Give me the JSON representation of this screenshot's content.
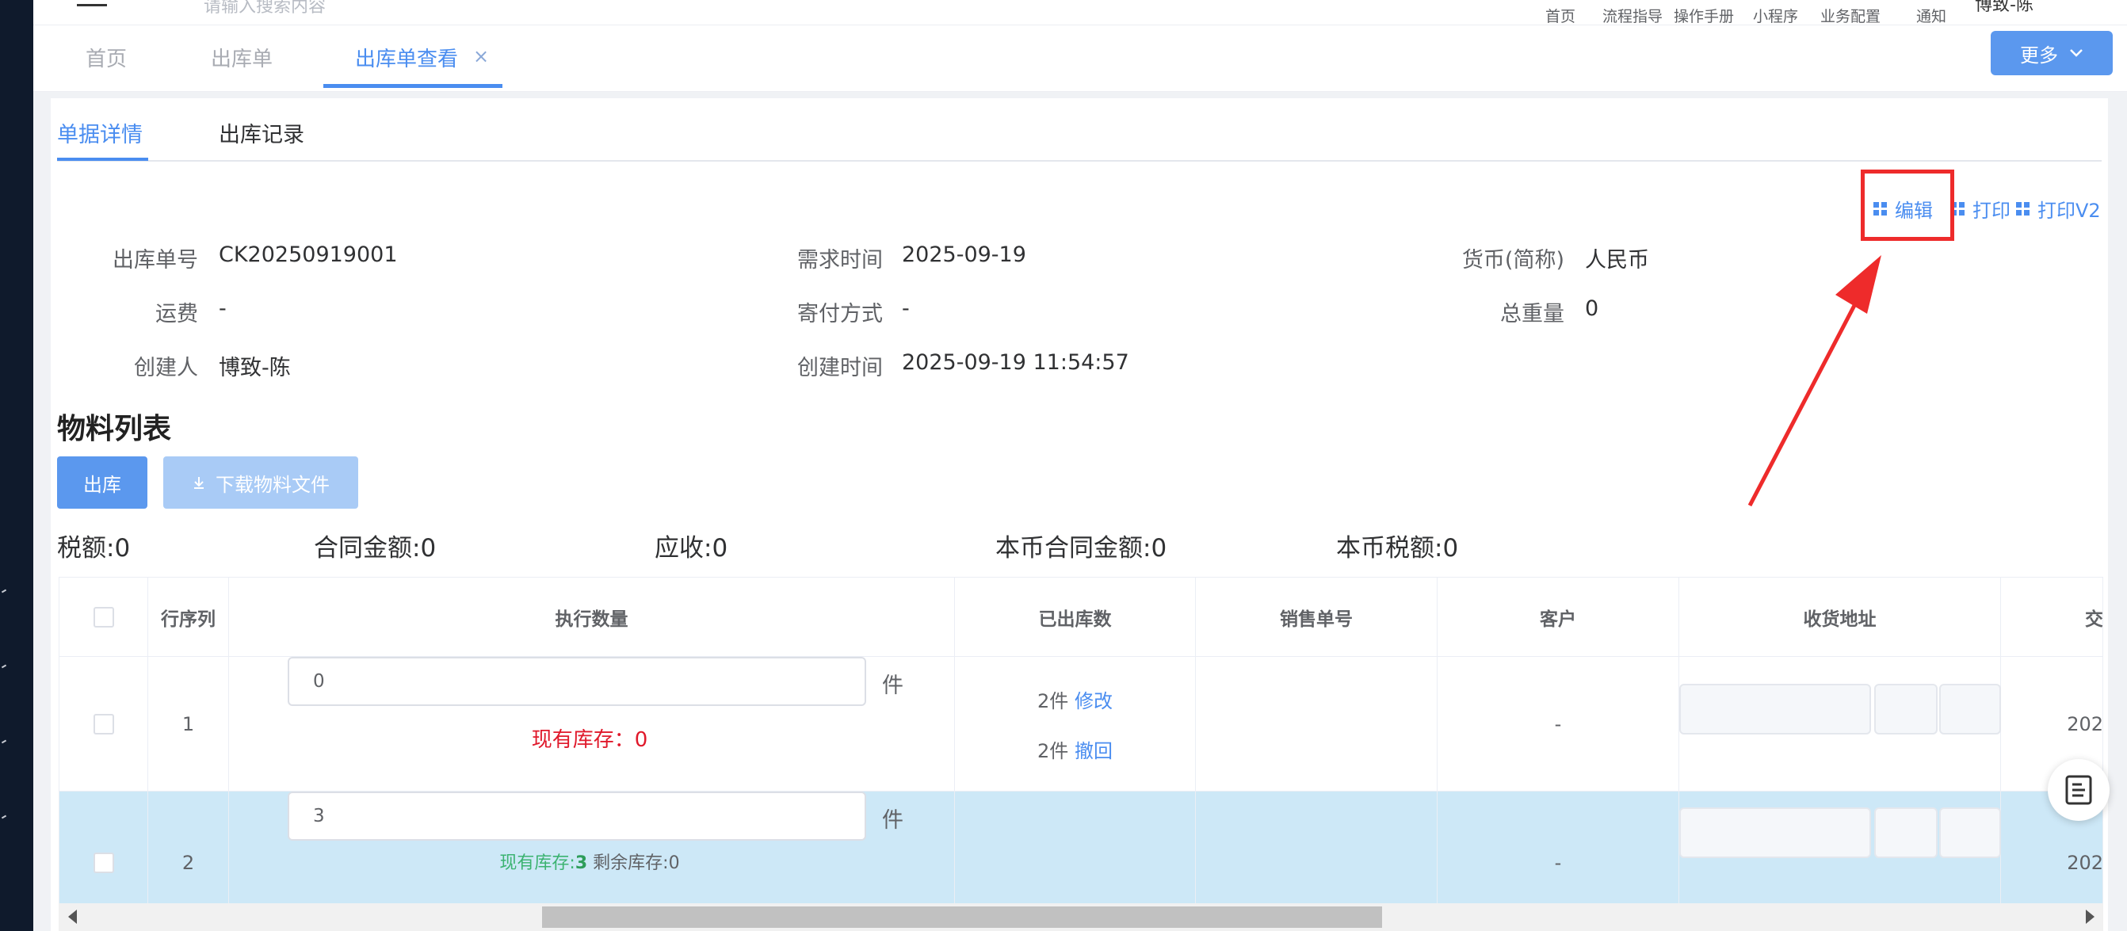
{
  "topbar": {
    "search_placeholder": "请输入搜索内容",
    "nav": [
      "首页",
      "流程指导",
      "操作手册",
      "小程序",
      "业务配置",
      "通知"
    ],
    "user": "博致-陈"
  },
  "tabs": {
    "items": [
      "首页",
      "出库单",
      "出库单查看"
    ],
    "close": "×",
    "more": "更多"
  },
  "subtabs": [
    "单据详情",
    "出库记录"
  ],
  "actions": [
    "编辑",
    "打印",
    "打印V2"
  ],
  "info": {
    "order_no_label": "出库单号",
    "order_no": "CK20250919001",
    "demand_time_label": "需求时间",
    "demand_time": "2025-09-19",
    "currency_label": "货币(简称)",
    "currency": "人民币",
    "freight_label": "运费",
    "freight": "-",
    "shipping_label": "寄付方式",
    "shipping": "-",
    "weight_label": "总重量",
    "weight": "0",
    "creator_label": "创建人",
    "creator": "博致-陈",
    "create_time_label": "创建时间",
    "create_time": "2025-09-19 11:54:57"
  },
  "materials": {
    "title": "物料列表",
    "btn_out": "出库",
    "btn_download": "下载物料文件"
  },
  "summary": [
    "税额:0",
    "合同金额:0",
    "应收:0",
    "本币合同金额:0",
    "本币税额:0"
  ],
  "table": {
    "headers": [
      "行序列",
      "执行数量",
      "已出库数",
      "销售单号",
      "客户",
      "收货地址",
      "交"
    ],
    "rows": [
      {
        "seq": "1",
        "qty": "0",
        "unit": "件",
        "stock_label": "现有库存：",
        "stock": "0",
        "out1": "2件",
        "out1_link": "修改",
        "out2": "2件",
        "out2_link": "撤回",
        "customer": "-",
        "date": "202"
      },
      {
        "seq": "2",
        "qty": "3",
        "unit": "件",
        "stock_label": "现有库存:",
        "stock": "3",
        "remain_label": "剩余库存:",
        "remain": "0",
        "customer": "-",
        "date": "202"
      }
    ]
  }
}
